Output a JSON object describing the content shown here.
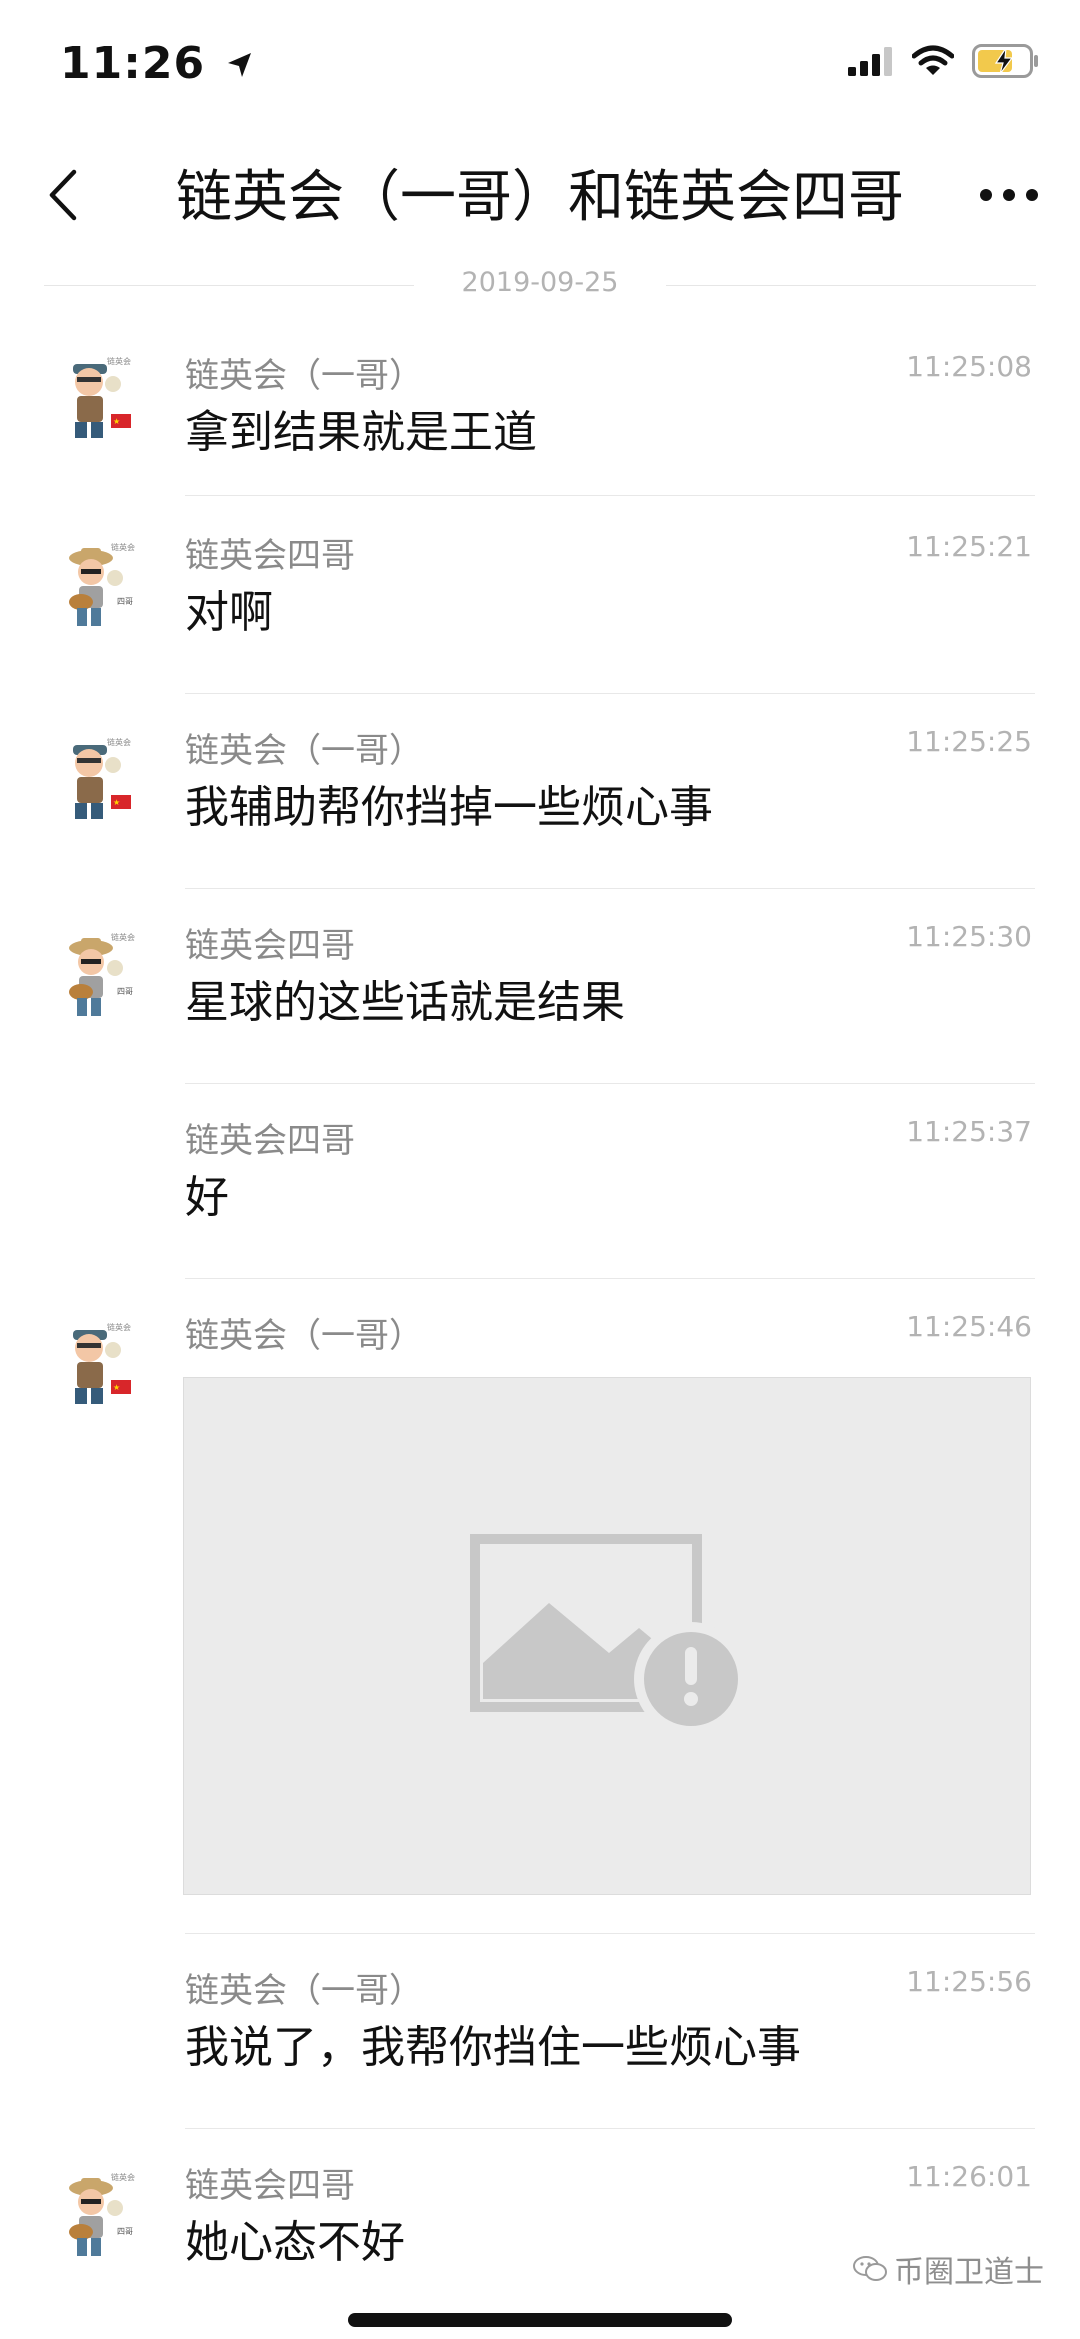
{
  "status_bar": {
    "time": "11:26"
  },
  "header": {
    "title": "链英会（一哥）和链英会四哥"
  },
  "date_divider": "2019-09-25",
  "messages": [
    {
      "sender": "链英会（一哥）",
      "time": "11:25:08",
      "text": "拿到结果就是王道",
      "avatar": "yige-avatar"
    },
    {
      "sender": "链英会四哥",
      "time": "11:25:21",
      "text": "对啊",
      "avatar": "sige-avatar"
    },
    {
      "sender": "链英会（一哥）",
      "time": "11:25:25",
      "text": "我辅助帮你挡掉一些烦心事",
      "avatar": "yige-avatar"
    },
    {
      "sender": "链英会四哥",
      "time": "11:25:30",
      "text": "星球的这些话就是结果",
      "avatar": "sige-avatar"
    },
    {
      "sender": "链英会四哥",
      "time": "11:25:37",
      "text": "好",
      "avatar": ""
    },
    {
      "sender": "链英会（一哥）",
      "time": "11:25:46",
      "image": "image-load-failed-icon",
      "avatar": "yige-avatar"
    },
    {
      "sender": "链英会（一哥）",
      "time": "11:25:56",
      "text": "我说了，我帮你挡住一些烦心事",
      "avatar": ""
    },
    {
      "sender": "链英会四哥",
      "time": "11:26:01",
      "text": "她心态不好",
      "avatar": "sige-avatar"
    }
  ],
  "watermark": {
    "icon": "wechat-official-account-icon",
    "text": "币圈卫道士"
  },
  "colors": {
    "sender": "#8a8a8a",
    "timestamp": "#b3b3b3",
    "separator": "#e8e8e8",
    "image_placeholder": "#ebebeb"
  }
}
